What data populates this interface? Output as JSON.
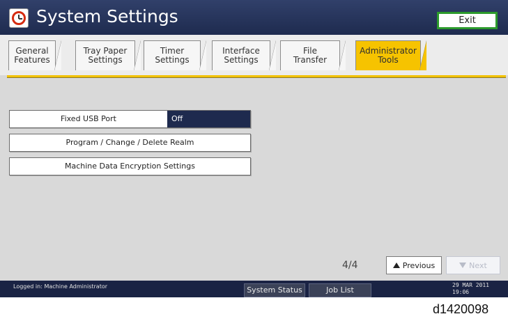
{
  "app": {
    "title": "System Settings",
    "exit_label": "Exit"
  },
  "tabs": [
    {
      "label": "General\nFeatures"
    },
    {
      "label": "Tray Paper\nSettings"
    },
    {
      "label": "Timer\nSettings"
    },
    {
      "label": "Interface\nSettings"
    },
    {
      "label": "File\nTransfer"
    },
    {
      "label": "Administrator\nTools",
      "active": true
    }
  ],
  "items": [
    {
      "label": "Fixed USB Port",
      "value": "Off"
    },
    {
      "label": "Program / Change / Delete Realm"
    },
    {
      "label": "Machine Data Encryption Settings"
    }
  ],
  "pager": {
    "text": "4/4",
    "previous_label": "Previous",
    "next_label": "Next"
  },
  "status": {
    "logged_in": "Logged in: Machine Administrator",
    "system_status_label": "System Status",
    "job_list_label": "Job List",
    "date": "29 MAR  2011",
    "time": "19:06"
  },
  "figure_id": "d1420098",
  "colors": {
    "titlebar": "#1e2b4f",
    "active_tab": "#f6c300",
    "exit_border": "#2c9a2c"
  }
}
